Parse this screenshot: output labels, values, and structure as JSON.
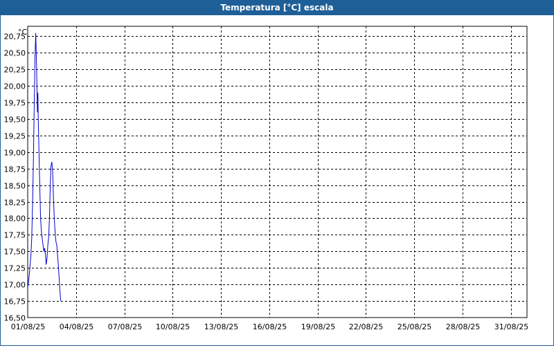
{
  "window": {
    "title": "Temperatura [°C] escala"
  },
  "chart_data": {
    "type": "line",
    "title": "Temperatura [°C] escala",
    "ylabel": "°C",
    "xlabel": "",
    "grid": true,
    "ylim": [
      16.5,
      20.9
    ],
    "xlim": [
      0,
      31
    ],
    "yticks": [
      "16,50",
      "16,75",
      "17,00",
      "17,25",
      "17,50",
      "17,75",
      "18,00",
      "18,25",
      "18,50",
      "18,75",
      "19,00",
      "19,25",
      "19,50",
      "19,75",
      "20,00",
      "20,25",
      "20,50",
      "20,75"
    ],
    "ytick_values": [
      16.5,
      16.75,
      17.0,
      17.25,
      17.5,
      17.75,
      18.0,
      18.25,
      18.5,
      18.75,
      19.0,
      19.25,
      19.5,
      19.75,
      20.0,
      20.25,
      20.5,
      20.75
    ],
    "xticks": [
      "01/08/25",
      "04/08/25",
      "07/08/25",
      "10/08/25",
      "13/08/25",
      "16/08/25",
      "19/08/25",
      "22/08/25",
      "25/08/25",
      "28/08/25",
      "31/08/25"
    ],
    "xtick_values": [
      0,
      3,
      6,
      9,
      12,
      15,
      18,
      21,
      24,
      27,
      30
    ],
    "series": [
      {
        "color": "#0000cc",
        "x": [
          0,
          0.05,
          0.1,
          0.15,
          0.2,
          0.25,
          0.3,
          0.35,
          0.4,
          0.45,
          0.5,
          0.55,
          0.6,
          0.63,
          0.66,
          0.7,
          0.75,
          0.8,
          0.85,
          0.9,
          0.95,
          1.0,
          1.05,
          1.1,
          1.15,
          1.2,
          1.25,
          1.3,
          1.35,
          1.4,
          1.45,
          1.5,
          1.55,
          1.6,
          1.65,
          1.7,
          1.75,
          1.8,
          1.85,
          1.9,
          1.95,
          2.0,
          2.05,
          2.1,
          2.15,
          2.2,
          2.25,
          2.3,
          2.35,
          2.4,
          2.45,
          2.5,
          2.55,
          2.6,
          2.65,
          2.7
        ],
        "y": [
          16.95,
          17.05,
          17.15,
          17.3,
          17.45,
          17.7,
          18.2,
          18.8,
          19.6,
          20.4,
          20.8,
          20.3,
          19.6,
          19.9,
          19.4,
          19.0,
          18.5,
          18.0,
          17.8,
          17.7,
          17.6,
          17.5,
          17.55,
          17.45,
          17.3,
          17.4,
          17.6,
          17.7,
          18.0,
          18.5,
          18.8,
          18.85,
          18.7,
          18.3,
          18.0,
          17.8,
          17.65,
          17.6,
          17.45,
          17.3,
          17.1,
          16.9,
          16.75,
          null,
          null,
          null,
          null,
          null,
          null,
          null,
          null,
          null,
          null,
          null,
          null,
          null
        ]
      }
    ]
  }
}
